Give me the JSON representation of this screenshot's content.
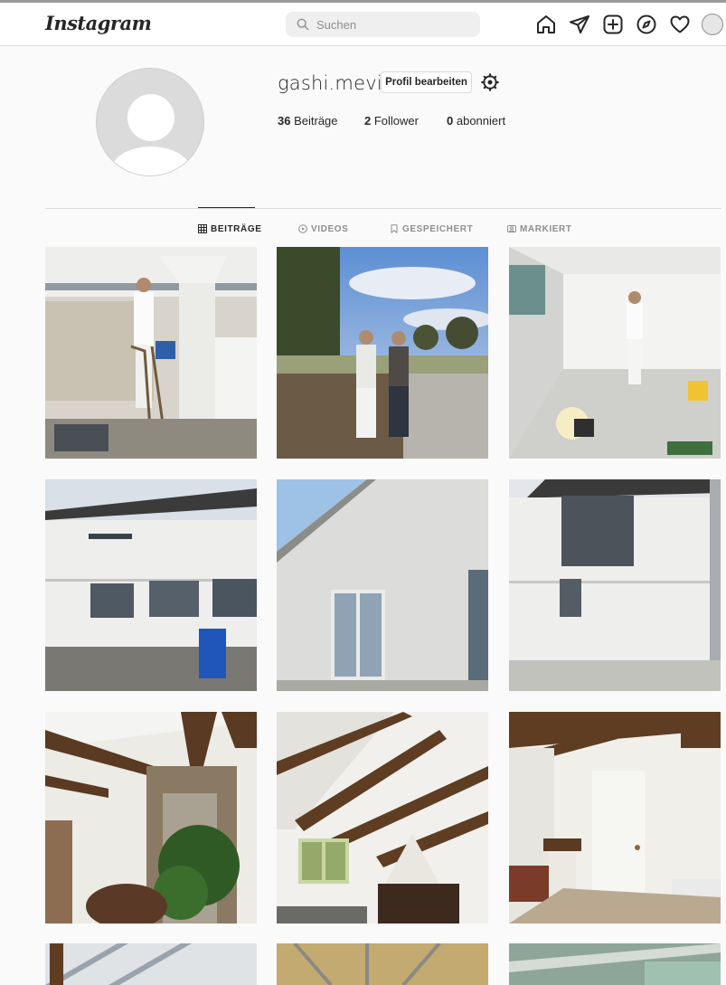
{
  "brand": {
    "logo_text": "Instagram"
  },
  "search": {
    "placeholder": "Suchen"
  },
  "nav": {
    "icons": [
      "home-icon",
      "paper-plane-icon",
      "new-post-icon",
      "explore-compass-icon",
      "heart-icon",
      "profile-avatar"
    ]
  },
  "profile": {
    "username": "gashi.mevi",
    "edit_label": "Profil bearbeiten",
    "stats": {
      "posts_count": "36",
      "posts_label": "Beiträge",
      "followers_count": "2",
      "followers_label": "Follower",
      "following_count": "0",
      "following_label": "abonniert"
    }
  },
  "tabs": [
    {
      "label": "BEITRÄGE",
      "icon": "grid-icon",
      "active": true
    },
    {
      "label": "VIDEOS",
      "icon": "video-play-icon",
      "active": false
    },
    {
      "label": "GESPEICHERT",
      "icon": "bookmark-icon",
      "active": false
    },
    {
      "label": "MARKIERT",
      "icon": "tagged-icon",
      "active": false
    }
  ],
  "colors": {
    "background": "#fafafa",
    "bar": "#ffffff",
    "border": "#dbdbdb",
    "text": "#262626",
    "muted": "#8e8e8e"
  },
  "posts_visible": 12
}
